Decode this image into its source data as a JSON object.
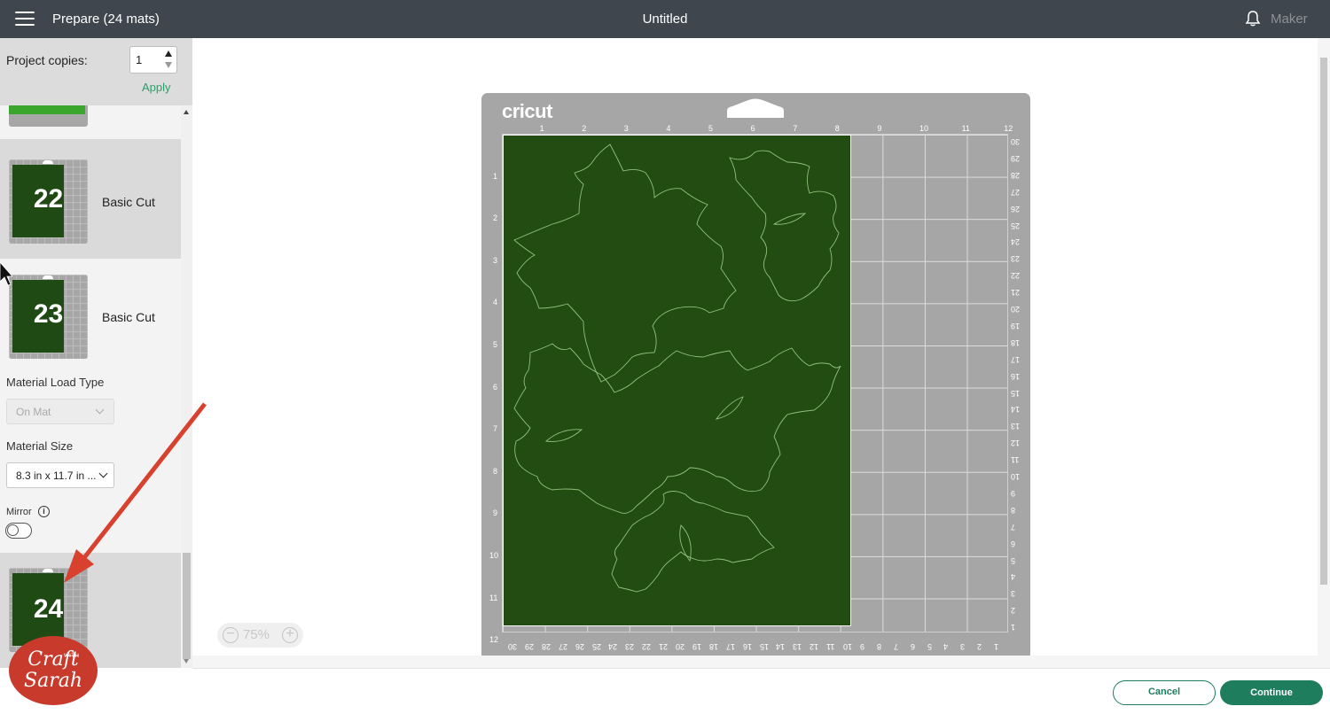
{
  "topbar": {
    "left_title": "Prepare (24 mats)",
    "center_title": "Untitled",
    "machine": "Maker"
  },
  "sidebar": {
    "copies_label": "Project copies:",
    "copies_value": "1",
    "apply_label": "Apply",
    "mats": [
      {
        "number": "22",
        "label": "Basic Cut"
      },
      {
        "number": "23",
        "label": "Basic Cut"
      },
      {
        "number": "24",
        "label": ""
      }
    ],
    "material_load_label": "Material Load Type",
    "material_load_value": "On Mat",
    "material_size_label": "Material Size",
    "material_size_value": "8.3 in x 11.7 in ...",
    "mirror_label": "Mirror"
  },
  "mat": {
    "logo": "cricut",
    "ruler_top": [
      "1",
      "2",
      "3",
      "4",
      "5",
      "6",
      "7",
      "8",
      "9",
      "10",
      "11",
      "12"
    ],
    "ruler_left": [
      "1",
      "2",
      "3",
      "4",
      "5",
      "6",
      "7",
      "8",
      "9",
      "10",
      "11",
      "12"
    ],
    "ruler_bottom": [
      "30",
      "29",
      "28",
      "27",
      "26",
      "25",
      "24",
      "23",
      "22",
      "21",
      "20",
      "19",
      "18",
      "17",
      "16",
      "15",
      "14",
      "13",
      "12",
      "11",
      "10",
      "9",
      "8",
      "7",
      "6",
      "5",
      "4",
      "3",
      "2",
      "1"
    ],
    "ruler_right": [
      "30",
      "29",
      "28",
      "27",
      "26",
      "25",
      "24",
      "23",
      "22",
      "21",
      "20",
      "19",
      "18",
      "17",
      "16",
      "15",
      "14",
      "13",
      "12",
      "11",
      "10",
      "9",
      "8",
      "7",
      "6",
      "5",
      "4",
      "3",
      "2",
      "1"
    ],
    "material_color": "#224c12"
  },
  "zoom": {
    "level": "75%"
  },
  "footer": {
    "cancel": "Cancel",
    "continue": "Continue"
  },
  "watermark": {
    "line1": "Craft",
    "small": "WITH",
    "line2": "Sarah"
  },
  "colors": {
    "topbar": "#3f464e",
    "accent": "#1e7d5d",
    "mat": "#a6a6a6",
    "arrow": "#d8412e"
  }
}
